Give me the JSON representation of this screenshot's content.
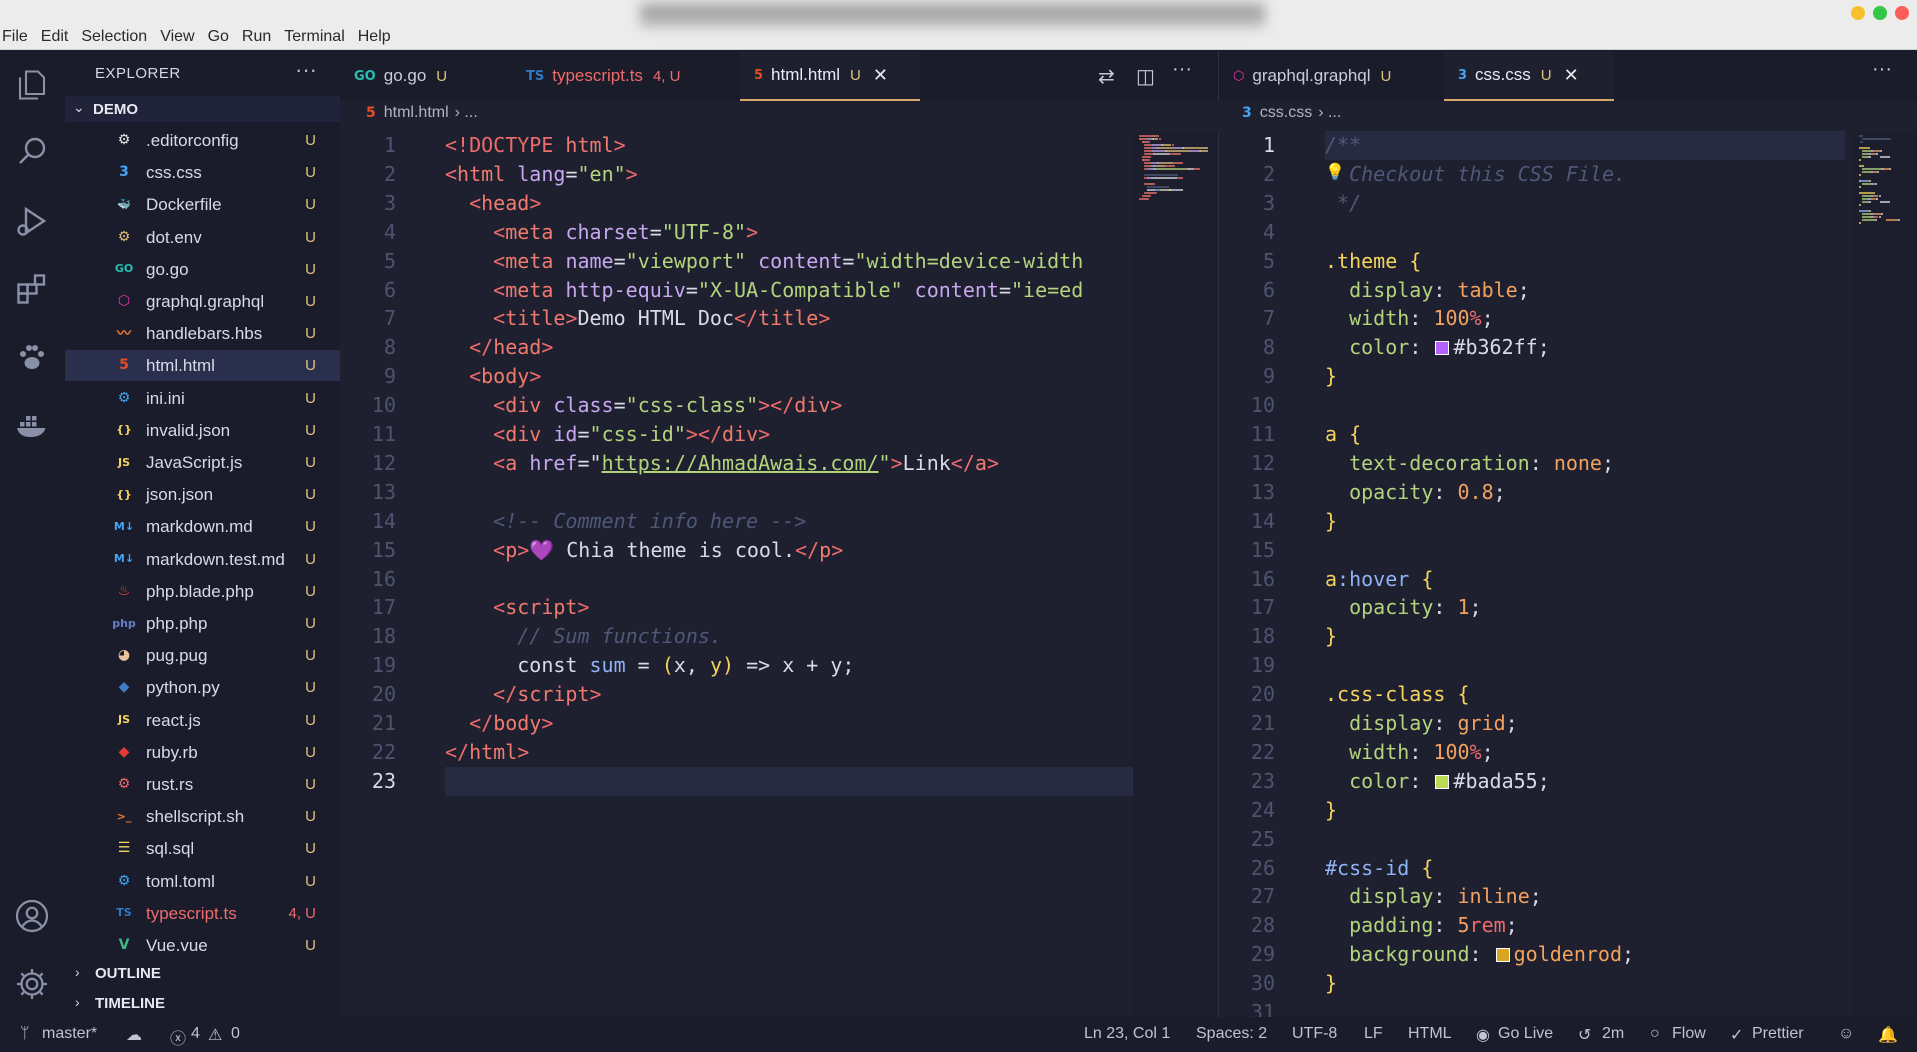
{
  "menu": [
    "File",
    "Edit",
    "Selection",
    "View",
    "Go",
    "Run",
    "Terminal",
    "Help"
  ],
  "explorer": {
    "title": "EXPLORER",
    "more": "···",
    "folder": "DEMO",
    "files": [
      {
        "name": ".editorconfig",
        "status": "U",
        "icon": "editorconfig-icon",
        "glyph": "⚙",
        "color": "#e8e8ee"
      },
      {
        "name": "css.css",
        "status": "U",
        "icon": "css-icon",
        "glyph": "3",
        "color": "#42a5f5"
      },
      {
        "name": "Dockerfile",
        "status": "U",
        "icon": "docker-icon",
        "glyph": "🐳",
        "color": "#2496ed"
      },
      {
        "name": "dot.env",
        "status": "U",
        "icon": "env-icon",
        "glyph": "⚙",
        "color": "#e2c27a"
      },
      {
        "name": "go.go",
        "status": "U",
        "icon": "go-icon",
        "glyph": "GO",
        "color": "#29beb0"
      },
      {
        "name": "graphql.graphql",
        "status": "U",
        "icon": "graphql-icon",
        "glyph": "⬡",
        "color": "#e535ab"
      },
      {
        "name": "handlebars.hbs",
        "status": "U",
        "icon": "handlebars-icon",
        "glyph": "〰",
        "color": "#f0772b"
      },
      {
        "name": "html.html",
        "status": "U",
        "icon": "html-icon",
        "glyph": "5",
        "color": "#e44d26",
        "selected": true
      },
      {
        "name": "ini.ini",
        "status": "U",
        "icon": "ini-icon",
        "glyph": "⚙",
        "color": "#42a5f5"
      },
      {
        "name": "invalid.json",
        "status": "U",
        "icon": "json-icon",
        "glyph": "{}",
        "color": "#f6d45c"
      },
      {
        "name": "JavaScript.js",
        "status": "U",
        "icon": "javascript-icon",
        "glyph": "JS",
        "color": "#f6d45c"
      },
      {
        "name": "json.json",
        "status": "U",
        "icon": "json-icon",
        "glyph": "{}",
        "color": "#f6d45c"
      },
      {
        "name": "markdown.md",
        "status": "U",
        "icon": "markdown-icon",
        "glyph": "M↓",
        "color": "#42a5f5"
      },
      {
        "name": "markdown.test.md",
        "status": "U",
        "icon": "markdown-icon",
        "glyph": "M↓",
        "color": "#42a5f5"
      },
      {
        "name": "php.blade.php",
        "status": "U",
        "icon": "blade-icon",
        "glyph": "♨",
        "color": "#f05340"
      },
      {
        "name": "php.php",
        "status": "U",
        "icon": "php-icon",
        "glyph": "php",
        "color": "#6a7dc8"
      },
      {
        "name": "pug.pug",
        "status": "U",
        "icon": "pug-icon",
        "glyph": "◕",
        "color": "#e8c39e"
      },
      {
        "name": "python.py",
        "status": "U",
        "icon": "python-icon",
        "glyph": "◆",
        "color": "#3f7cc4"
      },
      {
        "name": "react.js",
        "status": "U",
        "icon": "javascript-icon",
        "glyph": "JS",
        "color": "#f6d45c"
      },
      {
        "name": "ruby.rb",
        "status": "U",
        "icon": "ruby-icon",
        "glyph": "◆",
        "color": "#e53935"
      },
      {
        "name": "rust.rs",
        "status": "U",
        "icon": "rust-icon",
        "glyph": "⚙",
        "color": "#ee6b6b"
      },
      {
        "name": "shellscript.sh",
        "status": "U",
        "icon": "shell-icon",
        "glyph": ">_",
        "color": "#f0772b"
      },
      {
        "name": "sql.sql",
        "status": "U",
        "icon": "database-icon",
        "glyph": "☰",
        "color": "#f6d45c"
      },
      {
        "name": "toml.toml",
        "status": "U",
        "icon": "toml-icon",
        "glyph": "⚙",
        "color": "#42a5f5"
      },
      {
        "name": "typescript.ts",
        "status": "4, U",
        "icon": "typescript-icon",
        "glyph": "TS",
        "color": "#3178c6",
        "error": true
      },
      {
        "name": "Vue.vue",
        "status": "U",
        "icon": "vue-icon",
        "glyph": "V",
        "color": "#41b883"
      }
    ],
    "outline": "OUTLINE",
    "timeline": "TIMELINE"
  },
  "left_group": {
    "tabs": [
      {
        "label": "go.go",
        "mark": "U",
        "glyph": "GO",
        "color": "#29beb0",
        "icon": "go-icon"
      },
      {
        "label": "typescript.ts",
        "mark": "4, U",
        "glyph": "TS",
        "color": "#3178c6",
        "icon": "typescript-icon",
        "error": true
      },
      {
        "label": "html.html",
        "mark": "U",
        "glyph": "5",
        "color": "#e44d26",
        "icon": "html-icon",
        "active": true,
        "close": "✕"
      }
    ],
    "breadcrumb": {
      "file": "html.html",
      "rest": "› ..."
    }
  },
  "right_group": {
    "tabs": [
      {
        "label": "graphql.graphql",
        "mark": "U",
        "glyph": "⬡",
        "color": "#e535ab",
        "icon": "graphql-icon"
      },
      {
        "label": "css.css",
        "mark": "U",
        "glyph": "3",
        "color": "#42a5f5",
        "icon": "css-icon",
        "active": true,
        "close": "✕"
      }
    ],
    "breadcrumb": {
      "file": "css.css",
      "rest": "› ..."
    },
    "more": "···"
  },
  "html_code": [
    [
      [
        "kw",
        "<!DOCTYPE "
      ],
      [
        "tg",
        "html"
      ],
      [
        "kw",
        ">"
      ]
    ],
    [
      [
        "kw",
        "<"
      ],
      [
        "tg",
        "html "
      ],
      [
        "at",
        "lang"
      ],
      [
        "pl",
        "="
      ],
      [
        "st",
        "\"en\""
      ],
      [
        "kw",
        ">"
      ]
    ],
    [
      [
        "pl",
        "  "
      ],
      [
        "kw",
        "<"
      ],
      [
        "tg",
        "head"
      ],
      [
        "kw",
        ">"
      ]
    ],
    [
      [
        "pl",
        "    "
      ],
      [
        "kw",
        "<"
      ],
      [
        "tg",
        "meta "
      ],
      [
        "at",
        "charset"
      ],
      [
        "pl",
        "="
      ],
      [
        "st",
        "\"UTF-8\""
      ],
      [
        "kw",
        ">"
      ]
    ],
    [
      [
        "pl",
        "    "
      ],
      [
        "kw",
        "<"
      ],
      [
        "tg",
        "meta "
      ],
      [
        "at",
        "name"
      ],
      [
        "pl",
        "="
      ],
      [
        "st",
        "\"viewport\" "
      ],
      [
        "at",
        "content"
      ],
      [
        "pl",
        "="
      ],
      [
        "st",
        "\"width=device-width"
      ]
    ],
    [
      [
        "pl",
        "    "
      ],
      [
        "kw",
        "<"
      ],
      [
        "tg",
        "meta "
      ],
      [
        "at",
        "http-equiv"
      ],
      [
        "pl",
        "="
      ],
      [
        "st",
        "\"X-UA-Compatible\" "
      ],
      [
        "at",
        "content"
      ],
      [
        "pl",
        "="
      ],
      [
        "st",
        "\"ie=ed"
      ]
    ],
    [
      [
        "pl",
        "    "
      ],
      [
        "kw",
        "<"
      ],
      [
        "tg",
        "title"
      ],
      [
        "kw",
        ">"
      ],
      [
        "pl",
        "Demo HTML Doc"
      ],
      [
        "kw",
        "</"
      ],
      [
        "tg",
        "title"
      ],
      [
        "kw",
        ">"
      ]
    ],
    [
      [
        "pl",
        "  "
      ],
      [
        "kw",
        "</"
      ],
      [
        "tg",
        "head"
      ],
      [
        "kw",
        ">"
      ]
    ],
    [
      [
        "pl",
        "  "
      ],
      [
        "kw",
        "<"
      ],
      [
        "tg",
        "body"
      ],
      [
        "kw",
        ">"
      ]
    ],
    [
      [
        "pl",
        "    "
      ],
      [
        "kw",
        "<"
      ],
      [
        "tg",
        "div "
      ],
      [
        "at",
        "class"
      ],
      [
        "pl",
        "="
      ],
      [
        "st",
        "\"css-class\""
      ],
      [
        "kw",
        "></"
      ],
      [
        "tg",
        "div"
      ],
      [
        "kw",
        ">"
      ]
    ],
    [
      [
        "pl",
        "    "
      ],
      [
        "kw",
        "<"
      ],
      [
        "tg",
        "div "
      ],
      [
        "at",
        "id"
      ],
      [
        "pl",
        "="
      ],
      [
        "st",
        "\"css-id\""
      ],
      [
        "kw",
        "></"
      ],
      [
        "tg",
        "div"
      ],
      [
        "kw",
        ">"
      ]
    ],
    [
      [
        "pl",
        "    "
      ],
      [
        "kw",
        "<"
      ],
      [
        "tg",
        "a "
      ],
      [
        "at",
        "href"
      ],
      [
        "pl",
        "=\""
      ],
      [
        "link",
        "https://AhmadAwais.com/"
      ],
      [
        "st",
        "\""
      ],
      [
        "kw",
        ">"
      ],
      [
        "pl",
        "Link"
      ],
      [
        "kw",
        "</"
      ],
      [
        "tg",
        "a"
      ],
      [
        "kw",
        ">"
      ]
    ],
    [
      [
        "pl",
        ""
      ]
    ],
    [
      [
        "pl",
        "    "
      ],
      [
        "cm",
        "<!-- Comment info here -->"
      ]
    ],
    [
      [
        "pl",
        "    "
      ],
      [
        "kw",
        "<"
      ],
      [
        "tg",
        "p"
      ],
      [
        "kw",
        ">"
      ],
      [
        "at",
        "💜"
      ],
      [
        "pl",
        " Chia theme is cool."
      ],
      [
        "kw",
        "</"
      ],
      [
        "tg",
        "p"
      ],
      [
        "kw",
        ">"
      ]
    ],
    [
      [
        "pl",
        ""
      ]
    ],
    [
      [
        "pl",
        "    "
      ],
      [
        "kw",
        "<"
      ],
      [
        "tg",
        "script"
      ],
      [
        "kw",
        ">"
      ]
    ],
    [
      [
        "pl",
        "      "
      ],
      [
        "cm",
        "// Sum functions."
      ]
    ],
    [
      [
        "pl",
        "      "
      ],
      [
        "pl",
        "const "
      ],
      [
        "vr",
        "sum "
      ],
      [
        "pl",
        "= "
      ],
      [
        "br",
        "("
      ],
      [
        "pl",
        "x, "
      ],
      [
        "br",
        "y"
      ],
      [
        "br",
        ")"
      ],
      [
        "pl",
        " => x + y;"
      ]
    ],
    [
      [
        "pl",
        "    "
      ],
      [
        "kw",
        "</"
      ],
      [
        "tg",
        "script"
      ],
      [
        "kw",
        ">"
      ]
    ],
    [
      [
        "pl",
        "  "
      ],
      [
        "kw",
        "</"
      ],
      [
        "tg",
        "body"
      ],
      [
        "kw",
        ">"
      ]
    ],
    [
      [
        "kw",
        "</"
      ],
      [
        "tg",
        "html"
      ],
      [
        "kw",
        ">"
      ]
    ],
    [
      [
        "pl",
        ""
      ]
    ]
  ],
  "css_code": [
    [
      [
        "cm",
        "/**"
      ]
    ],
    [
      [
        "pl",
        "  "
      ],
      [
        "cm",
        "Checkout this CSS File."
      ]
    ],
    [
      [
        "pl",
        " "
      ],
      [
        "cm",
        "*/"
      ]
    ],
    [
      [
        "pl",
        ""
      ]
    ],
    [
      [
        "sel",
        ".theme "
      ],
      [
        "br",
        "{"
      ]
    ],
    [
      [
        "pl",
        "  "
      ],
      [
        "prop",
        "display"
      ],
      [
        "pl",
        ": "
      ],
      [
        "val",
        "table"
      ],
      [
        "pl",
        ";"
      ]
    ],
    [
      [
        "pl",
        "  "
      ],
      [
        "prop",
        "width"
      ],
      [
        "pl",
        ": "
      ],
      [
        "num",
        "100"
      ],
      [
        "kw",
        "%"
      ],
      [
        "pl",
        ";"
      ]
    ],
    [
      [
        "pl",
        "  "
      ],
      [
        "prop",
        "color"
      ],
      [
        "pl",
        ": "
      ],
      [
        "swatch",
        "#b362ff"
      ],
      [
        "pl",
        "#b362ff;"
      ]
    ],
    [
      [
        "br",
        "}"
      ]
    ],
    [
      [
        "pl",
        ""
      ]
    ],
    [
      [
        "sel",
        "a "
      ],
      [
        "br",
        "{"
      ]
    ],
    [
      [
        "pl",
        "  "
      ],
      [
        "prop",
        "text-decoration"
      ],
      [
        "pl",
        ": "
      ],
      [
        "val",
        "none"
      ],
      [
        "pl",
        ";"
      ]
    ],
    [
      [
        "pl",
        "  "
      ],
      [
        "prop",
        "opacity"
      ],
      [
        "pl",
        ": "
      ],
      [
        "num",
        "0.8"
      ],
      [
        "pl",
        ";"
      ]
    ],
    [
      [
        "br",
        "}"
      ]
    ],
    [
      [
        "pl",
        ""
      ]
    ],
    [
      [
        "sel",
        "a"
      ],
      [
        "vr",
        ":hover "
      ],
      [
        "br",
        "{"
      ]
    ],
    [
      [
        "pl",
        "  "
      ],
      [
        "prop",
        "opacity"
      ],
      [
        "pl",
        ": "
      ],
      [
        "num",
        "1"
      ],
      [
        "pl",
        ";"
      ]
    ],
    [
      [
        "br",
        "}"
      ]
    ],
    [
      [
        "pl",
        ""
      ]
    ],
    [
      [
        "sel",
        ".css-class "
      ],
      [
        "br",
        "{"
      ]
    ],
    [
      [
        "pl",
        "  "
      ],
      [
        "prop",
        "display"
      ],
      [
        "pl",
        ": "
      ],
      [
        "val",
        "grid"
      ],
      [
        "pl",
        ";"
      ]
    ],
    [
      [
        "pl",
        "  "
      ],
      [
        "prop",
        "width"
      ],
      [
        "pl",
        ": "
      ],
      [
        "num",
        "100"
      ],
      [
        "kw",
        "%"
      ],
      [
        "pl",
        ";"
      ]
    ],
    [
      [
        "pl",
        "  "
      ],
      [
        "prop",
        "color"
      ],
      [
        "pl",
        ": "
      ],
      [
        "swatch",
        "#bada55"
      ],
      [
        "pl",
        "#bada55;"
      ]
    ],
    [
      [
        "br",
        "}"
      ]
    ],
    [
      [
        "pl",
        ""
      ]
    ],
    [
      [
        "vr",
        "#css-id "
      ],
      [
        "br",
        "{"
      ]
    ],
    [
      [
        "pl",
        "  "
      ],
      [
        "prop",
        "display"
      ],
      [
        "pl",
        ": "
      ],
      [
        "val",
        "inline"
      ],
      [
        "pl",
        ";"
      ]
    ],
    [
      [
        "pl",
        "  "
      ],
      [
        "prop",
        "padding"
      ],
      [
        "pl",
        ": "
      ],
      [
        "num",
        "5"
      ],
      [
        "kw",
        "rem"
      ],
      [
        "pl",
        ";"
      ]
    ],
    [
      [
        "pl",
        "  "
      ],
      [
        "prop",
        "background"
      ],
      [
        "pl",
        ": "
      ],
      [
        "swatch",
        "#daa520"
      ],
      [
        "val",
        "goldenrod"
      ],
      [
        "pl",
        ";"
      ]
    ],
    [
      [
        "br",
        "}"
      ]
    ],
    [
      [
        "pl",
        ""
      ]
    ]
  ],
  "status": {
    "branch": "master*",
    "errors": "4",
    "warnings": "0",
    "position": "Ln 23, Col 1",
    "spaces": "Spaces: 2",
    "encoding": "UTF-8",
    "eol": "LF",
    "language": "HTML",
    "golive": "Go Live",
    "time": "2m",
    "flow": "Flow",
    "prettier": "Prettier"
  }
}
